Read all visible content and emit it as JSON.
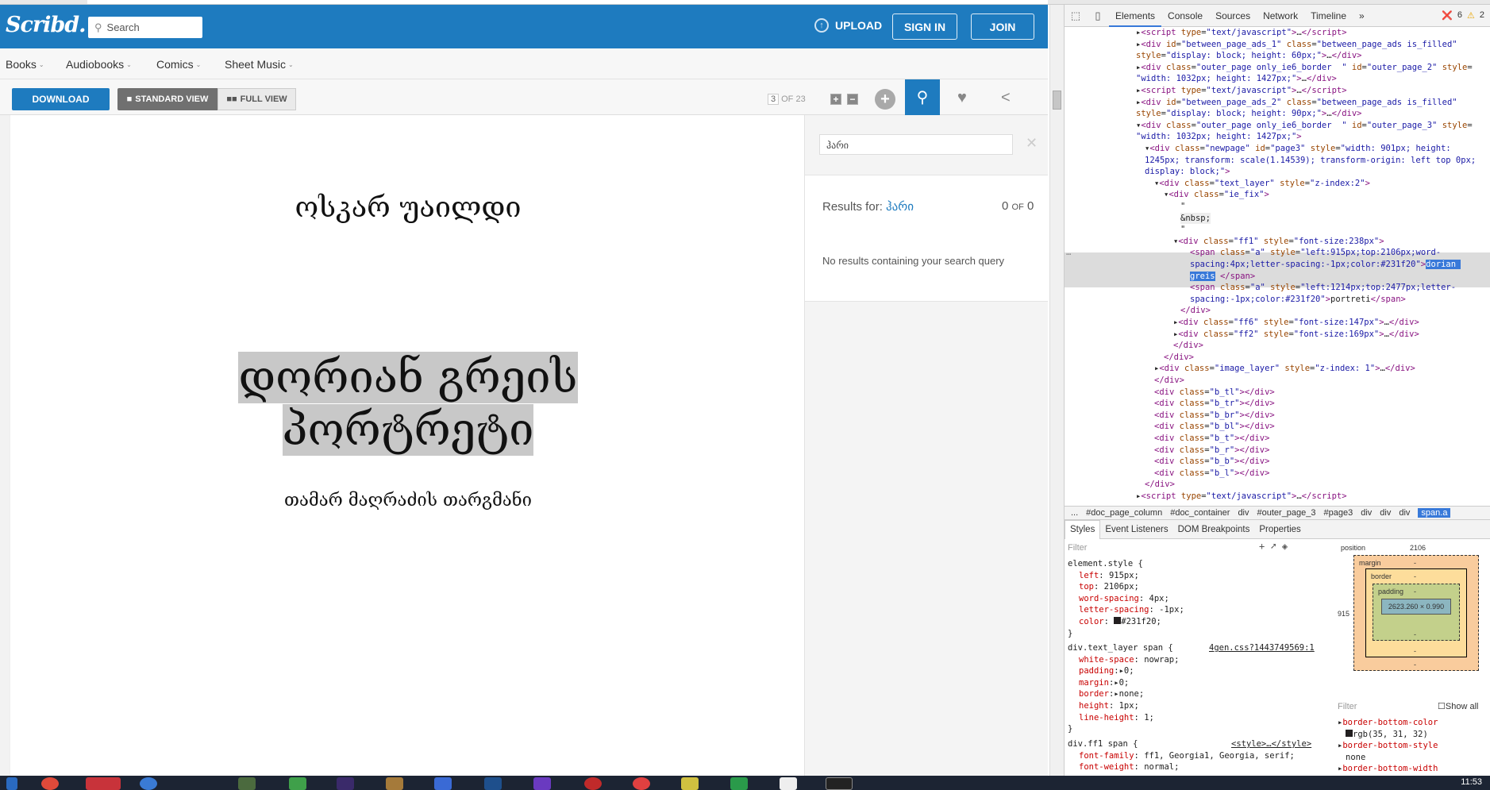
{
  "scribd": {
    "logo": "Scribd.",
    "search_placeholder": "Search",
    "upload": "UPLOAD",
    "sign_in": "SIGN IN",
    "join": "JOIN",
    "nav": [
      "Books",
      "Audiobooks",
      "Comics",
      "Sheet Music"
    ],
    "download": "DOWNLOAD",
    "standard_view": "STANDARD VIEW",
    "full_view": "FULL VIEW",
    "page_current": "3",
    "page_total": "OF 23"
  },
  "document": {
    "author": "ოსკარ უაილდი",
    "title_line1": "დორიან გრეის",
    "title_line2": "პორტრეტი",
    "translator": "თამარ მაღრაძის თარგმანი"
  },
  "search_panel": {
    "query": "ჰარი",
    "results_label": "Results for:",
    "results_query": "ჰარი",
    "count": "0",
    "of": "OF",
    "total": "0",
    "no_results": "No results containing your search query"
  },
  "devtools": {
    "tabs": [
      "Elements",
      "Console",
      "Sources",
      "Network",
      "Timeline"
    ],
    "errors": "6",
    "warnings": "2",
    "breadcrumbs": [
      "...",
      "#doc_page_column",
      "#doc_container",
      "div",
      "#outer_page_3",
      "#page3",
      "div",
      "div",
      "div",
      "span.a"
    ],
    "style_tabs": [
      "Styles",
      "Event Listeners",
      "DOM Breakpoints",
      "Properties"
    ],
    "filter": "Filter",
    "box_position_label": "position",
    "box_position_val": "2106",
    "box_left_val": "915",
    "box_margin": "margin",
    "box_border": "border",
    "box_padding": "padding",
    "box_dash": "-",
    "box_content": "2623.260 × 0.990",
    "computed_filter": "Filter",
    "show_all": "Show all",
    "computed": [
      {
        "prop": "border-bottom-color",
        "val": "rgb(35, 31, 32)"
      },
      {
        "prop": "border-bottom-style",
        "val": "none"
      },
      {
        "prop": "border-bottom-width",
        "val": ""
      }
    ]
  },
  "taskbar": {
    "clock": "11:53"
  }
}
